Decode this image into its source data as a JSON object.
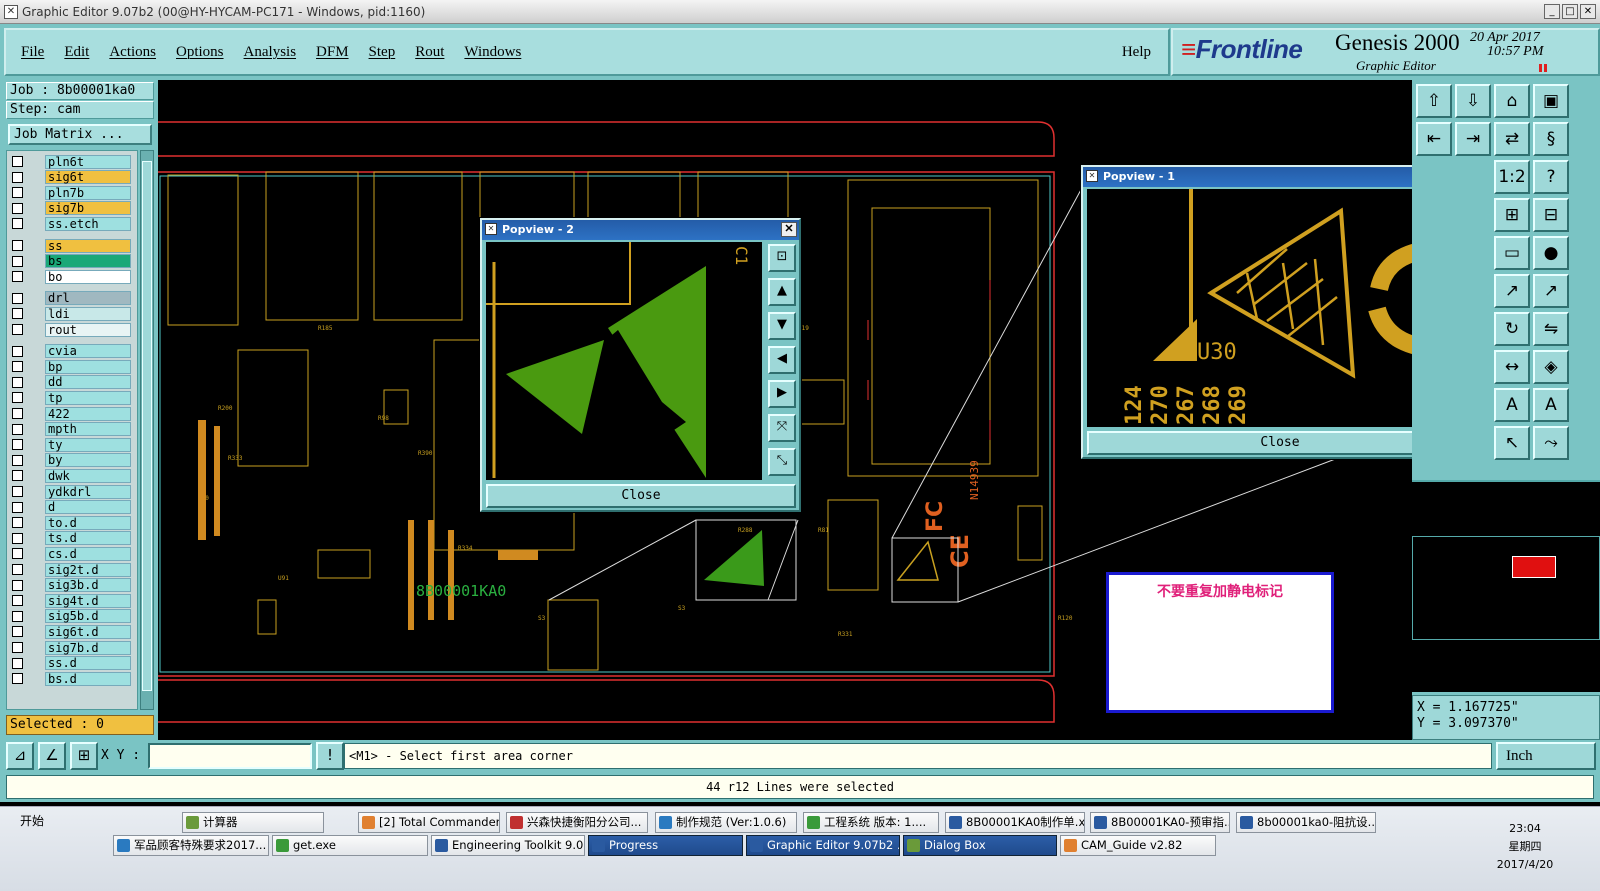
{
  "window": {
    "title": "Graphic Editor 9.07b2 (00@HY-HYCAM-PC171 - Windows, pid:1160)",
    "buttons": [
      "_",
      "□",
      "✕"
    ]
  },
  "menu": {
    "items": [
      "File",
      "Edit",
      "Actions",
      "Options",
      "Analysis",
      "DFM",
      "Step",
      "Rout",
      "Windows"
    ],
    "help": "Help"
  },
  "brand": {
    "logo": "Frontline",
    "product": "Genesis 2000",
    "subtitle": "Graphic Editor",
    "date": "20 Apr 2017",
    "time": "10:57 PM"
  },
  "job": {
    "job_line": "Job : 8b00001ka0",
    "step_line": "Step: cam",
    "matrix_button": "Job Matrix ..."
  },
  "layers": [
    {
      "name": "pln6t",
      "color": "#9ee0e0"
    },
    {
      "name": "sig6t",
      "color": "#f0c040"
    },
    {
      "name": "pln7b",
      "color": "#9ee0e0"
    },
    {
      "name": "sig7b",
      "color": "#f0c040"
    },
    {
      "name": "ss.etch",
      "color": "#9ee0e0"
    },
    {
      "name": "ss",
      "color": "#f0c040"
    },
    {
      "name": "bs",
      "color": "#1aa878"
    },
    {
      "name": "bo",
      "color": "#ffffff"
    },
    {
      "name": "drl",
      "color": "#a0b8c0"
    },
    {
      "name": "ldi",
      "color": "#c8e8e8"
    },
    {
      "name": "rout",
      "color": "#e8f4f4"
    },
    {
      "name": "cvia",
      "color": "#9ee0e0"
    },
    {
      "name": "bp",
      "color": "#9ee0e0"
    },
    {
      "name": "dd",
      "color": "#9ee0e0"
    },
    {
      "name": "tp",
      "color": "#9ee0e0"
    },
    {
      "name": "422",
      "color": "#9ee0e0"
    },
    {
      "name": "mpth",
      "color": "#9ee0e0"
    },
    {
      "name": "ty",
      "color": "#9ee0e0"
    },
    {
      "name": "by",
      "color": "#9ee0e0"
    },
    {
      "name": "dwk",
      "color": "#9ee0e0"
    },
    {
      "name": "ydkdrl",
      "color": "#9ee0e0"
    },
    {
      "name": "d",
      "color": "#9ee0e0"
    },
    {
      "name": "to.d",
      "color": "#9ee0e0"
    },
    {
      "name": "ts.d",
      "color": "#9ee0e0"
    },
    {
      "name": "cs.d",
      "color": "#9ee0e0"
    },
    {
      "name": "sig2t.d",
      "color": "#9ee0e0"
    },
    {
      "name": "sig3b.d",
      "color": "#9ee0e0"
    },
    {
      "name": "sig4t.d",
      "color": "#9ee0e0"
    },
    {
      "name": "sig5b.d",
      "color": "#9ee0e0"
    },
    {
      "name": "sig6t.d",
      "color": "#9ee0e0"
    },
    {
      "name": "sig7b.d",
      "color": "#9ee0e0"
    },
    {
      "name": "ss.d",
      "color": "#9ee0e0"
    },
    {
      "name": "bs.d",
      "color": "#9ee0e0"
    }
  ],
  "selected_count": "Selected : 0",
  "popview2": {
    "title": "Popview - 2",
    "close": "Close"
  },
  "popview1": {
    "title": "Popview - 1",
    "close": "Close",
    "label": "U30",
    "numbers": [
      "124",
      "270",
      "267",
      "268",
      "269"
    ]
  },
  "board": {
    "part_number": "8B00001KA0",
    "chip_label": "N14939"
  },
  "note": {
    "text": "不要重复加静电标记"
  },
  "coords": {
    "x": "X = 1.167725\"",
    "y": "Y = 3.097370\""
  },
  "command": {
    "xy_label": "X Y :",
    "prompt": "<M1> - Select first area corner",
    "unit": "Inch"
  },
  "status": {
    "message": "44 r12 Lines were selected"
  },
  "taskbar": {
    "start": "开始",
    "row1": [
      "计算器",
      "[2] Total Commander ...",
      "兴森快捷衡阳分公司...",
      "制作规范 (Ver:1.0.6)",
      "工程系统 版本: 1....",
      "8B00001KA0制作单.x...",
      "8B00001KA0-预审指...",
      "8b00001ka0-阻抗设..."
    ],
    "row2": [
      "军品顾客特殊要求2017...",
      "get.exe",
      "Engineering Toolkit 9.07...",
      "Progress",
      "Graphic Editor 9.07b2 ...",
      "Dialog Box",
      "CAM_Guide v2.82"
    ],
    "clock_time": "23:04",
    "clock_day": "星期四",
    "clock_date": "2017/4/20"
  }
}
